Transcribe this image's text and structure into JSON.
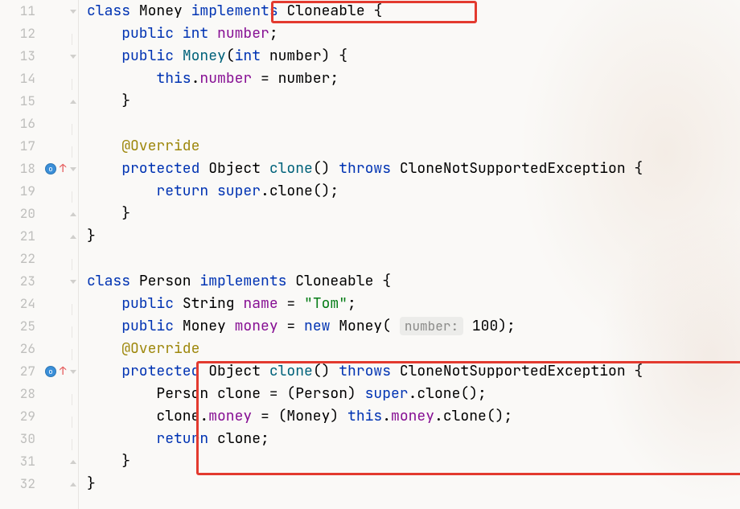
{
  "startLine": 11,
  "highlight_boxes": {
    "top": "implements Cloneable {",
    "bottom": "clone() override block"
  },
  "lines": {
    "11": [
      {
        "t": "class ",
        "c": "kw"
      },
      {
        "t": "Money ",
        "c": "type"
      },
      {
        "t": "implements ",
        "c": "kw"
      },
      {
        "t": "Cloneable ",
        "c": "type"
      },
      {
        "t": "{"
      }
    ],
    "12": [
      {
        "t": "    "
      },
      {
        "t": "public int ",
        "c": "kw"
      },
      {
        "t": "number",
        "c": "field"
      },
      {
        "t": ";"
      }
    ],
    "13": [
      {
        "t": "    "
      },
      {
        "t": "public ",
        "c": "kw"
      },
      {
        "t": "Money",
        "c": "fn"
      },
      {
        "t": "("
      },
      {
        "t": "int ",
        "c": "kw"
      },
      {
        "t": "number) {"
      }
    ],
    "14": [
      {
        "t": "        "
      },
      {
        "t": "this",
        "c": "kw"
      },
      {
        "t": "."
      },
      {
        "t": "number",
        "c": "field"
      },
      {
        "t": " = number;"
      }
    ],
    "15": [
      {
        "t": "    }"
      }
    ],
    "16": [],
    "17": [
      {
        "t": "    "
      },
      {
        "t": "@Override",
        "c": "ann"
      }
    ],
    "18": [
      {
        "t": "    "
      },
      {
        "t": "protected ",
        "c": "kw"
      },
      {
        "t": "Object ",
        "c": "type"
      },
      {
        "t": "clone",
        "c": "fn"
      },
      {
        "t": "() "
      },
      {
        "t": "throws ",
        "c": "kw"
      },
      {
        "t": "CloneNotSupportedException {",
        "c": "type"
      }
    ],
    "19": [
      {
        "t": "        "
      },
      {
        "t": "return super",
        "c": "kw"
      },
      {
        "t": ".clone();"
      }
    ],
    "20": [
      {
        "t": "    }"
      }
    ],
    "21": [
      {
        "t": "}"
      }
    ],
    "22": [],
    "23": [
      {
        "t": "class ",
        "c": "kw"
      },
      {
        "t": "Person ",
        "c": "type"
      },
      {
        "t": "implements ",
        "c": "kw"
      },
      {
        "t": "Cloneable ",
        "c": "type"
      },
      {
        "t": "{"
      }
    ],
    "24": [
      {
        "t": "    "
      },
      {
        "t": "public ",
        "c": "kw"
      },
      {
        "t": "String ",
        "c": "type"
      },
      {
        "t": "name",
        "c": "field"
      },
      {
        "t": " = "
      },
      {
        "t": "\"Tom\"",
        "c": "str"
      },
      {
        "t": ";"
      }
    ],
    "25": [
      {
        "t": "    "
      },
      {
        "t": "public ",
        "c": "kw"
      },
      {
        "t": "Money ",
        "c": "type"
      },
      {
        "t": "money",
        "c": "field"
      },
      {
        "t": " = "
      },
      {
        "t": "new ",
        "c": "kw"
      },
      {
        "t": "Money( ",
        "c": "type"
      },
      {
        "hint": "number:"
      },
      {
        "t": " 100);"
      }
    ],
    "26": [
      {
        "t": "    "
      },
      {
        "t": "@Override",
        "c": "ann"
      }
    ],
    "27": [
      {
        "t": "    "
      },
      {
        "t": "protected ",
        "c": "kw"
      },
      {
        "t": "Object ",
        "c": "type"
      },
      {
        "t": "clone",
        "c": "fn"
      },
      {
        "t": "() "
      },
      {
        "t": "throws ",
        "c": "kw"
      },
      {
        "t": "CloneNotSupportedException {",
        "c": "type"
      }
    ],
    "28": [
      {
        "t": "        Person clone = (Person) "
      },
      {
        "t": "super",
        "c": "kw"
      },
      {
        "t": ".clone();"
      }
    ],
    "29": [
      {
        "t": "        clone."
      },
      {
        "t": "money",
        "c": "field"
      },
      {
        "t": " = (Money) "
      },
      {
        "t": "this",
        "c": "kw"
      },
      {
        "t": "."
      },
      {
        "t": "money",
        "c": "field"
      },
      {
        "t": ".clone();"
      }
    ],
    "30": [
      {
        "t": "        "
      },
      {
        "t": "return ",
        "c": "kw"
      },
      {
        "t": "clone;"
      }
    ],
    "31": [
      {
        "t": "    }"
      }
    ],
    "32": [
      {
        "t": "}"
      }
    ]
  },
  "gutterMarks": {
    "18": "override",
    "27": "override"
  },
  "foldTop": [
    11,
    13,
    18,
    23,
    27
  ],
  "foldBottom": [
    15,
    20,
    21,
    31,
    32
  ]
}
